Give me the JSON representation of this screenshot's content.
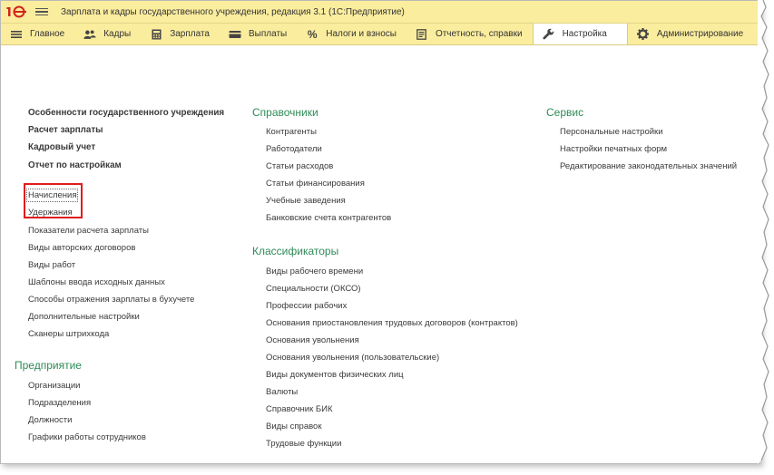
{
  "titlebar": {
    "title": "Зарплата и кадры государственного учреждения, редакция 3.1  (1С:Предприятие)",
    "logo_text": "1С"
  },
  "sections": [
    {
      "label": "Главное",
      "icon": "hamburger-icon"
    },
    {
      "label": "Кадры",
      "icon": "people-icon"
    },
    {
      "label": "Зарплата",
      "icon": "calculator-icon"
    },
    {
      "label": "Выплаты",
      "icon": "wallet-icon"
    },
    {
      "label": "Налоги и взносы",
      "icon": "percent-icon"
    },
    {
      "label": "Отчетность, справки",
      "icon": "report-icon"
    },
    {
      "label": "Настройка",
      "icon": "wrench-icon",
      "active": true
    },
    {
      "label": "Администрирование",
      "icon": "gear-icon"
    }
  ],
  "left": {
    "bold_links": [
      "Особенности государственного учреждения",
      "Расчет зарплаты",
      "Кадровый учет",
      "Отчет по настройкам"
    ],
    "links": [
      "Начисления",
      "Удержания",
      "Показатели расчета зарплаты",
      "Виды авторских договоров",
      "Виды работ",
      "Шаблоны ввода исходных данных",
      "Способы отражения зарплаты в бухучете",
      "Дополнительные настройки",
      "Сканеры штрихкода"
    ],
    "group_enterprise": {
      "title": "Предприятие",
      "links": [
        "Организации",
        "Подразделения",
        "Должности",
        "Графики работы сотрудников"
      ]
    }
  },
  "middle": {
    "group_catalogs": {
      "title": "Справочники",
      "links": [
        "Контрагенты",
        "Работодатели",
        "Статьи расходов",
        "Статьи финансирования",
        "Учебные заведения",
        "Банковские счета контрагентов"
      ]
    },
    "group_classifiers": {
      "title": "Классификаторы",
      "links": [
        "Виды рабочего времени",
        "Специальности (ОКСО)",
        "Профессии рабочих",
        "Основания приостановления трудовых договоров (контрактов)",
        "Основания увольнения",
        "Основания увольнения (пользовательские)",
        "Виды документов физических лиц",
        "Валюты",
        "Справочник БИК",
        "Виды справок",
        "Трудовые функции"
      ]
    }
  },
  "right": {
    "group_service": {
      "title": "Сервис",
      "links": [
        "Персональные настройки",
        "Настройки печатных форм",
        "Редактирование законодательных значений"
      ]
    }
  },
  "colors": {
    "panel_bg": "#fbed9e",
    "group_title": "#2e8b57",
    "highlight": "#e21b1b"
  }
}
